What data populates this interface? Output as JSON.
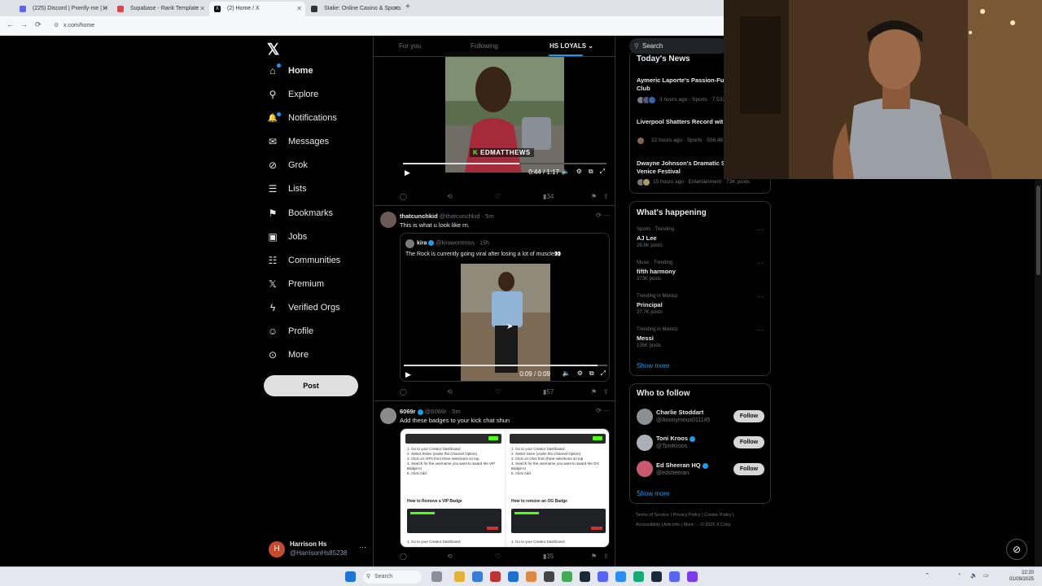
{
  "browser": {
    "tabs": [
      {
        "label": "(225) Discord | Pxerify-me | H",
        "color": "#5865f2"
      },
      {
        "label": "Supabase - Rank Template",
        "color": "#d44"
      },
      {
        "label": "(2) Home / X",
        "color": "#000"
      },
      {
        "label": "Stake: Online Casino & Sports",
        "color": "#333"
      }
    ],
    "new_tab": "+",
    "url": "x.com/home",
    "back": "←",
    "forward": "→",
    "reload": "⟳"
  },
  "sidebar": {
    "logo": "𝕏",
    "items": [
      {
        "label": "Home",
        "icon": "⌂",
        "name": "home"
      },
      {
        "label": "Explore",
        "icon": "⚲",
        "name": "explore"
      },
      {
        "label": "Notifications",
        "icon": "🔔",
        "name": "notifications"
      },
      {
        "label": "Messages",
        "icon": "✉",
        "name": "messages"
      },
      {
        "label": "Grok",
        "icon": "⊘",
        "name": "grok"
      },
      {
        "label": "Lists",
        "icon": "☰",
        "name": "lists"
      },
      {
        "label": "Bookmarks",
        "icon": "⚑",
        "name": "bookmarks"
      },
      {
        "label": "Jobs",
        "icon": "▣",
        "name": "jobs"
      },
      {
        "label": "Communities",
        "icon": "☷",
        "name": "communities"
      },
      {
        "label": "Premium",
        "icon": "𝕏",
        "name": "premium"
      },
      {
        "label": "Verified Orgs",
        "icon": "ϟ",
        "name": "verified-orgs"
      },
      {
        "label": "Profile",
        "icon": "☺",
        "name": "profile"
      },
      {
        "label": "More",
        "icon": "⊙",
        "name": "more"
      }
    ],
    "post_label": "Post",
    "account": {
      "initial": "H",
      "name": "Harrison Hs",
      "handle": "@HarrisonHs85238",
      "more": "···"
    }
  },
  "timeline": {
    "tabs": [
      "For you",
      "Following",
      "HS LOYALS ⌄"
    ],
    "video1": {
      "overlay_text": "EDMATTHEWS",
      "time": "0:44 / 1:17",
      "progress": 0.57
    },
    "video1_actions": {
      "views": "34"
    },
    "tweet1": {
      "name": "thatcunchkid",
      "handle": "@thatcunchkid",
      "time": "· 5m",
      "text": "This is what u look like rn.",
      "quote": {
        "name": "kira",
        "handle": "@kirawontmiss",
        "time": "· 15h",
        "text": "The Rock is currently going viral after losing a lot of muscle👀"
      },
      "video_time": "0:09 / 0:09",
      "progress": 0.95,
      "views": "57"
    },
    "tweet2": {
      "name": "6069r",
      "handle": "@6069r",
      "time": "· 5m",
      "text": "Add these badges to your kick chat shun",
      "views": "35",
      "img_left": {
        "steps": [
          "1.   Go to your Creator Dashboard",
          "2.   Select Roles (under the Channel Option)",
          "3.   Click on VIPs from three selections on top",
          "4.   Search for the username you want to award the VIP Badge to",
          "5.   Click Add"
        ],
        "heading": "How to Remove a VIP Badge",
        "step_bottom": "1.   Go to your Creator Dashboard"
      },
      "img_right": {
        "steps": [
          "1.   Go to your Creator Dashboard",
          "2.   Select Seen (under the Channel Option)",
          "3.   Click on OGs from three selections on top",
          "4.   Search for the username you want to award the OG Badge to",
          "5.   Click Add"
        ],
        "heading": "How to remove an OG Badge",
        "step_bottom": "1.   Go to your Creator Dashboard"
      }
    }
  },
  "right": {
    "search_placeholder": "Search",
    "news_title": "Today's News",
    "news": [
      {
        "title": "Aymeric Laporte's Passion-Fu… Athletic Club",
        "meta": "3 hours ago · Sports · 7,533…"
      },
      {
        "title": "Liverpool Shatters Record wit… Signing",
        "meta": "22 hours ago · Sports · 556.4K…"
      },
      {
        "title": "Dwayne Johnson's Dramatic S… Wows Venice Festival",
        "meta": "15 hours ago · Entertainment · 73K posts"
      }
    ],
    "happening_title": "What's happening",
    "trends": [
      {
        "context": "Sports · Trending",
        "name": "AJ Lee",
        "posts": "26.6K posts"
      },
      {
        "context": "Music · Trending",
        "name": "fifth harmony",
        "posts": "373K posts"
      },
      {
        "context": "Trending in Mexico",
        "name": "Principal",
        "posts": "37.7K posts"
      },
      {
        "context": "Trending in Mexico",
        "name": "Messi",
        "posts": "135K posts"
      }
    ],
    "show_more": "Show more",
    "wtf_title": "Who to follow",
    "follows": [
      {
        "name": "Charlie Stoddart",
        "handle": "@Anonymous011145",
        "verified": false
      },
      {
        "name": "Toni Kroos",
        "handle": "@ToniKroos",
        "verified": true
      },
      {
        "name": "Ed Sheeran HQ",
        "handle": "@edsheeran",
        "verified": true
      }
    ],
    "follow_label": "Follow",
    "footer_line1": "Terms of Service  |  Privacy Policy  |  Cookie Policy  |",
    "footer_line2": "Accessibility  |  Ads info  |  More ···  © 2025 X Corp."
  },
  "taskbar": {
    "search": "Search",
    "time": "22:20",
    "date": "01/09/2025"
  }
}
